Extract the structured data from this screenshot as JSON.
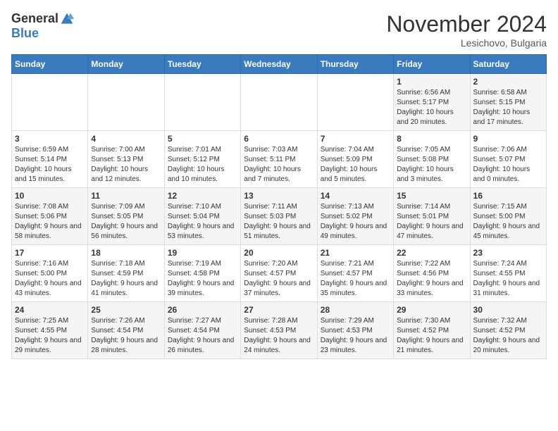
{
  "header": {
    "logo_general": "General",
    "logo_blue": "Blue",
    "month_title": "November 2024",
    "location": "Lesichovo, Bulgaria"
  },
  "weekdays": [
    "Sunday",
    "Monday",
    "Tuesday",
    "Wednesday",
    "Thursday",
    "Friday",
    "Saturday"
  ],
  "weeks": [
    [
      {
        "day": "",
        "info": ""
      },
      {
        "day": "",
        "info": ""
      },
      {
        "day": "",
        "info": ""
      },
      {
        "day": "",
        "info": ""
      },
      {
        "day": "",
        "info": ""
      },
      {
        "day": "1",
        "info": "Sunrise: 6:56 AM\nSunset: 5:17 PM\nDaylight: 10 hours\nand 20 minutes."
      },
      {
        "day": "2",
        "info": "Sunrise: 6:58 AM\nSunset: 5:15 PM\nDaylight: 10 hours\nand 17 minutes."
      }
    ],
    [
      {
        "day": "3",
        "info": "Sunrise: 6:59 AM\nSunset: 5:14 PM\nDaylight: 10 hours\nand 15 minutes."
      },
      {
        "day": "4",
        "info": "Sunrise: 7:00 AM\nSunset: 5:13 PM\nDaylight: 10 hours\nand 12 minutes."
      },
      {
        "day": "5",
        "info": "Sunrise: 7:01 AM\nSunset: 5:12 PM\nDaylight: 10 hours\nand 10 minutes."
      },
      {
        "day": "6",
        "info": "Sunrise: 7:03 AM\nSunset: 5:11 PM\nDaylight: 10 hours\nand 7 minutes."
      },
      {
        "day": "7",
        "info": "Sunrise: 7:04 AM\nSunset: 5:09 PM\nDaylight: 10 hours\nand 5 minutes."
      },
      {
        "day": "8",
        "info": "Sunrise: 7:05 AM\nSunset: 5:08 PM\nDaylight: 10 hours\nand 3 minutes."
      },
      {
        "day": "9",
        "info": "Sunrise: 7:06 AM\nSunset: 5:07 PM\nDaylight: 10 hours\nand 0 minutes."
      }
    ],
    [
      {
        "day": "10",
        "info": "Sunrise: 7:08 AM\nSunset: 5:06 PM\nDaylight: 9 hours\nand 58 minutes."
      },
      {
        "day": "11",
        "info": "Sunrise: 7:09 AM\nSunset: 5:05 PM\nDaylight: 9 hours\nand 56 minutes."
      },
      {
        "day": "12",
        "info": "Sunrise: 7:10 AM\nSunset: 5:04 PM\nDaylight: 9 hours\nand 53 minutes."
      },
      {
        "day": "13",
        "info": "Sunrise: 7:11 AM\nSunset: 5:03 PM\nDaylight: 9 hours\nand 51 minutes."
      },
      {
        "day": "14",
        "info": "Sunrise: 7:13 AM\nSunset: 5:02 PM\nDaylight: 9 hours\nand 49 minutes."
      },
      {
        "day": "15",
        "info": "Sunrise: 7:14 AM\nSunset: 5:01 PM\nDaylight: 9 hours\nand 47 minutes."
      },
      {
        "day": "16",
        "info": "Sunrise: 7:15 AM\nSunset: 5:00 PM\nDaylight: 9 hours\nand 45 minutes."
      }
    ],
    [
      {
        "day": "17",
        "info": "Sunrise: 7:16 AM\nSunset: 5:00 PM\nDaylight: 9 hours\nand 43 minutes."
      },
      {
        "day": "18",
        "info": "Sunrise: 7:18 AM\nSunset: 4:59 PM\nDaylight: 9 hours\nand 41 minutes."
      },
      {
        "day": "19",
        "info": "Sunrise: 7:19 AM\nSunset: 4:58 PM\nDaylight: 9 hours\nand 39 minutes."
      },
      {
        "day": "20",
        "info": "Sunrise: 7:20 AM\nSunset: 4:57 PM\nDaylight: 9 hours\nand 37 minutes."
      },
      {
        "day": "21",
        "info": "Sunrise: 7:21 AM\nSunset: 4:57 PM\nDaylight: 9 hours\nand 35 minutes."
      },
      {
        "day": "22",
        "info": "Sunrise: 7:22 AM\nSunset: 4:56 PM\nDaylight: 9 hours\nand 33 minutes."
      },
      {
        "day": "23",
        "info": "Sunrise: 7:24 AM\nSunset: 4:55 PM\nDaylight: 9 hours\nand 31 minutes."
      }
    ],
    [
      {
        "day": "24",
        "info": "Sunrise: 7:25 AM\nSunset: 4:55 PM\nDaylight: 9 hours\nand 29 minutes."
      },
      {
        "day": "25",
        "info": "Sunrise: 7:26 AM\nSunset: 4:54 PM\nDaylight: 9 hours\nand 28 minutes."
      },
      {
        "day": "26",
        "info": "Sunrise: 7:27 AM\nSunset: 4:54 PM\nDaylight: 9 hours\nand 26 minutes."
      },
      {
        "day": "27",
        "info": "Sunrise: 7:28 AM\nSunset: 4:53 PM\nDaylight: 9 hours\nand 24 minutes."
      },
      {
        "day": "28",
        "info": "Sunrise: 7:29 AM\nSunset: 4:53 PM\nDaylight: 9 hours\nand 23 minutes."
      },
      {
        "day": "29",
        "info": "Sunrise: 7:30 AM\nSunset: 4:52 PM\nDaylight: 9 hours\nand 21 minutes."
      },
      {
        "day": "30",
        "info": "Sunrise: 7:32 AM\nSunset: 4:52 PM\nDaylight: 9 hours\nand 20 minutes."
      }
    ]
  ]
}
